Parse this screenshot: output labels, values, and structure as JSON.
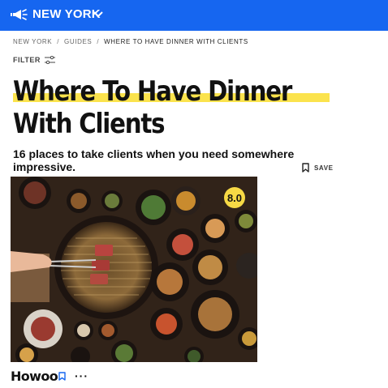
{
  "header": {
    "city": "NEW YORK",
    "icon": "megaphone-icon",
    "dropdown_icon": "chevron-down-icon",
    "background": "#1666f0"
  },
  "breadcrumb": {
    "items": [
      "NEW YORK",
      "GUIDES",
      "WHERE TO HAVE DINNER WITH CLIENTS"
    ],
    "separator": "/"
  },
  "filter": {
    "label": "FILTER",
    "icon": "sliders-icon"
  },
  "article": {
    "title_line_1": "Where To Have Dinner",
    "title_line_2": "With Clients",
    "highlight_color": "#fbe34d",
    "subtitle": "16 places to take clients when you need somewhere impressive.",
    "save_label": "SAVE"
  },
  "listing": {
    "rating": "8.0",
    "rating_color": "#f6d945",
    "name": "Howoo",
    "more_label": "···"
  }
}
